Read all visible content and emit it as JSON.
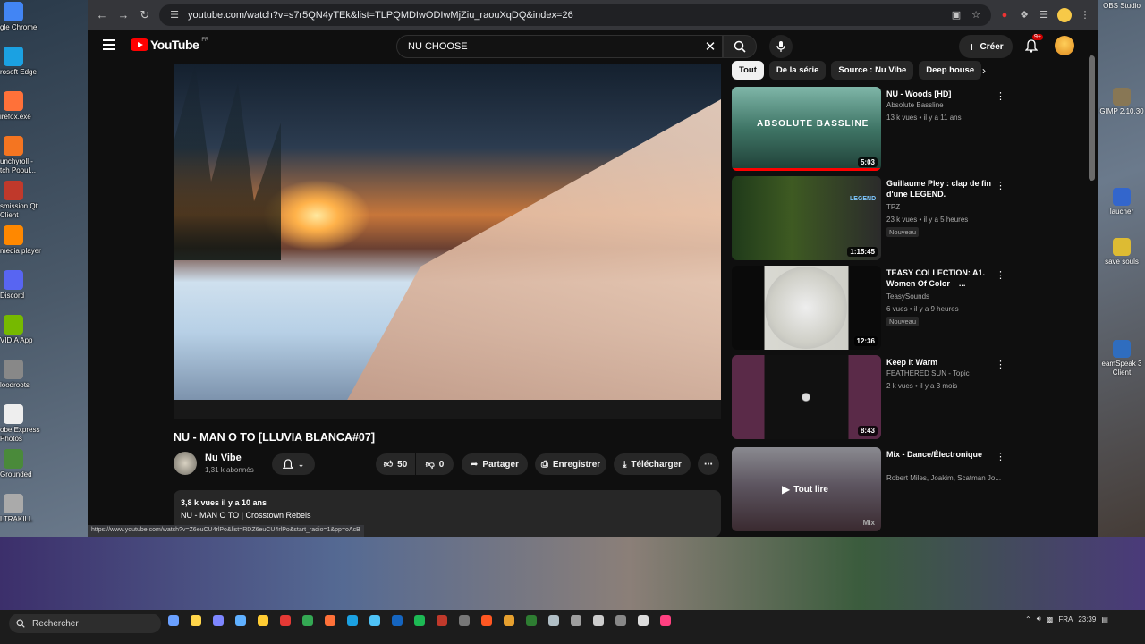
{
  "desktop_left": [
    {
      "label": "gle Chrome",
      "color": "#4285f4"
    },
    {
      "label": "rosoft Edge",
      "color": "#1ba1e2"
    },
    {
      "label": "irefox.exe",
      "color": "#ff7139"
    },
    {
      "label": "unchyroll -\ntch Popul...",
      "color": "#f47521"
    },
    {
      "label": "smission Qt\nClient",
      "color": "#c0392b"
    },
    {
      "label": "media player",
      "color": "#ff8800"
    },
    {
      "label": "Discord",
      "color": "#5865f2"
    },
    {
      "label": "VIDIA App",
      "color": "#76b900"
    },
    {
      "label": "loodroots",
      "color": "#888888"
    },
    {
      "label": "obe Express\nPhotos",
      "color": "#eeeeee"
    },
    {
      "label": "Grounded",
      "color": "#4a8a3a"
    },
    {
      "label": "LTRAKILL",
      "color": "#aaaaaa"
    }
  ],
  "desktop_right": [
    {
      "label": "OBS Studio",
      "color": "#333333"
    },
    {
      "label": "GIMP 2.10.30",
      "color": "#887755"
    },
    {
      "label": "laucher",
      "color": "#3366cc"
    },
    {
      "label": "save souls",
      "color": "#ddbb33"
    },
    {
      "label": "eamSpeak 3\nClient",
      "color": "#2f6dbf"
    }
  ],
  "browser": {
    "url": "youtube.com/watch?v=s7r5QN4yTEk&list=TLPQMDIwODIwMjZiu_raouXqDQ&index=26",
    "status_url": "https://www.youtube.com/watch?v=Z6euCU4rlPo&list=RDZ6euCU4rlPo&start_radio=1&pp=oAcB"
  },
  "header": {
    "logo_text": "YouTube",
    "logo_region": "FR",
    "search_query": "NU CHOOSE",
    "create_label": "Créer",
    "notifications": "9+"
  },
  "video": {
    "title": "NU - MAN O TO [LLUVIA BLANCA#07]",
    "channel": "Nu Vibe",
    "subscribers": "1,31 k abonnés",
    "likes": "50",
    "dislikes": "0",
    "share_label": "Partager",
    "save_label": "Enregistrer",
    "download_label": "Télécharger",
    "views_age": "3,8 k vues  il y a 10 ans",
    "description_line": "NU - MAN O TO | Crosstown Rebels"
  },
  "chips": [
    "Tout",
    "De la série",
    "Source : Nu Vibe",
    "Deep house"
  ],
  "recommendations": [
    {
      "title": "NU - Woods [HD]",
      "channel": "Absolute Bassline",
      "meta": "13 k vues • il y a 11 ans",
      "duration": "5:03",
      "thumb_text": "ABSOLUTE BASSLINE",
      "new": "",
      "progress": 1.0
    },
    {
      "title": "Guillaume Pley : clap de fin d'une LEGEND.",
      "channel": "TPZ",
      "meta": "23 k vues • il y a 5 heures",
      "duration": "1:15:45",
      "thumb_text": "LEGEND",
      "new": "Nouveau",
      "progress": 0
    },
    {
      "title": "TEASY COLLECTION: A1. Women Of Color – ...",
      "channel": "TeasySounds",
      "meta": "6 vues • il y a 9 heures",
      "duration": "12:36",
      "thumb_text": "",
      "new": "Nouveau",
      "progress": 0
    },
    {
      "title": "Keep It Warm",
      "channel": "FEATHERED SUN - Topic",
      "meta": "2 k vues • il y a 3 mois",
      "duration": "8:43",
      "thumb_text": "",
      "new": "",
      "progress": 0
    },
    {
      "title": "Mix - Dance/Électronique",
      "channel": "Robert Miles, Joakim, Scatman Jo...",
      "meta": "",
      "duration": "",
      "thumb_text": "Tout lire",
      "mix_label": "Mix",
      "new": "",
      "progress": 0
    }
  ],
  "taskbar": {
    "search_placeholder": "Rechercher",
    "lang": "FRA",
    "time": "23:39"
  },
  "colors": {
    "yt_red": "#ff0000",
    "page_bg": "#0f0f0f",
    "pill_bg": "#272727"
  }
}
